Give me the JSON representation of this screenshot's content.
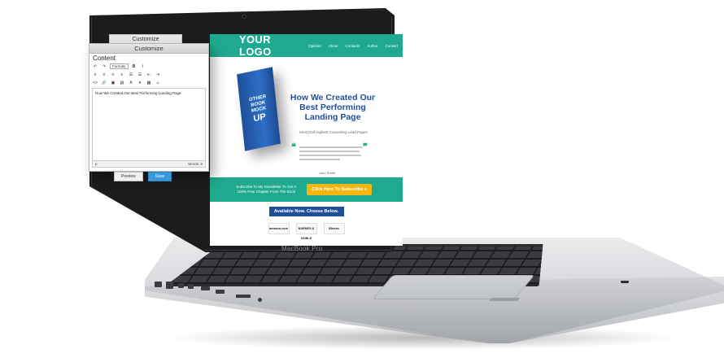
{
  "panel": {
    "back_title": "Customize",
    "title": "Customize",
    "section": "Content",
    "formats_label": "Formats",
    "editor_text": "How We Created Our Best Performing Landing Page",
    "status_path": "p",
    "words_label": "Words: 8",
    "preview_label": "Preview",
    "save_label": "Save"
  },
  "site": {
    "logo": "YOUR LOGO",
    "nav": [
      "Options",
      "About",
      "Contacts",
      "Author",
      "Contact"
    ],
    "book_lines": [
      "OTHER",
      "BOOK",
      "MOCK",
      "UP"
    ],
    "hero_title": "How We Created Our Best Performing Landing Page",
    "hero_sub": "Most Dull Highest Converting Lead Pages",
    "quote_author": "John Smith",
    "cta_text": "Subscribe To My Newsletter To Get A 100% Free Chapter From The Book",
    "cta_button": "Click Here To Subscribe »",
    "available_banner": "Available Now. Choose Below.",
    "stores": [
      "amazon.com",
      "BARNES & NOBLE",
      "iBooks"
    ]
  },
  "laptop": {
    "brand": "MacBook Pro"
  },
  "colors": {
    "teal": "#1fa98f",
    "navy": "#1f4e9a",
    "cta_yellow": "#f5b70f",
    "save_blue": "#3a9ad9"
  }
}
